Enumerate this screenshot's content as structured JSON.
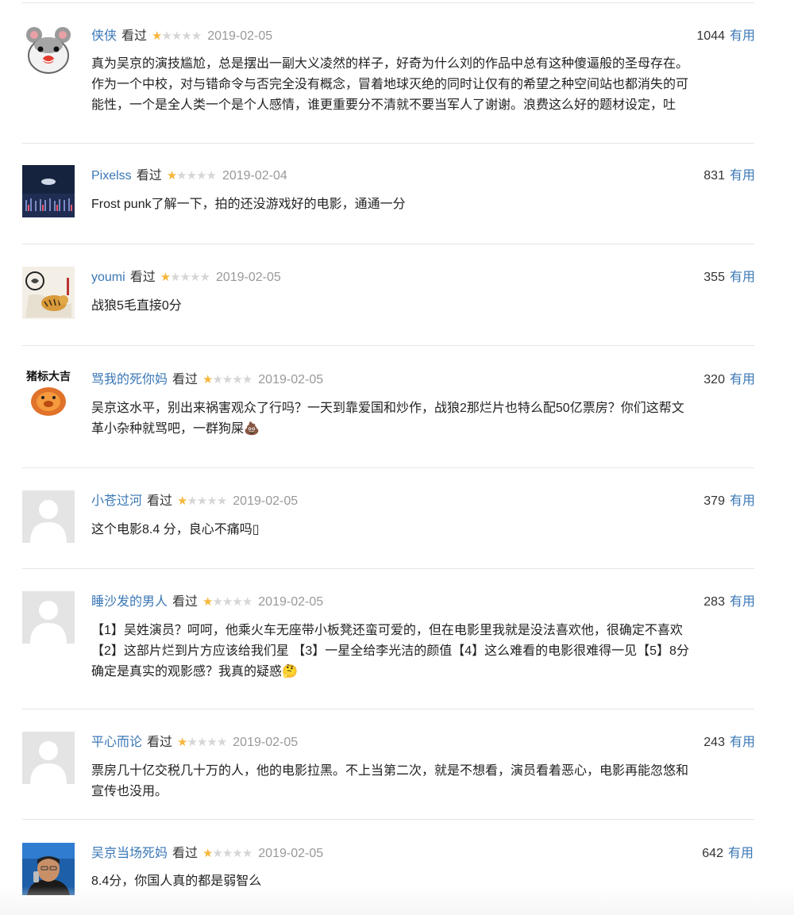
{
  "comments": [
    {
      "user": "侠侠",
      "seen": "看过",
      "stars": "★",
      "stars_off": "★★★★",
      "date": "2019-02-05",
      "count": "1044",
      "useful": "有用",
      "avatar": "hamster-avatar",
      "lines": [
        "真为吴京的演技尴尬，总是摆出一副大义凌然的样子，好奇为什么刘的作品中总有这种傻逼般的圣母存在。",
        "作为一个中校，对与错命令与否完全没有概念，冒着地球灭绝的同时让仅有的希望之种空间站也都消失的可",
        "能性，一个是全人类一个是个人感情，谁更重要分不清就不要当军人了谢谢。浪费这么好的题材设定，吐"
      ]
    },
    {
      "user": "Pixelss",
      "seen": "看过",
      "stars": "★",
      "stars_off": "★★★★",
      "date": "2019-02-04",
      "count": "831",
      "useful": "有用",
      "avatar": "night-scene-avatar",
      "lines": [
        "Frost punk了解一下，拍的还没游戏好的电影，通通一分"
      ]
    },
    {
      "user": "youmi",
      "seen": "看过",
      "stars": "★",
      "stars_off": "★★★★",
      "date": "2019-02-05",
      "count": "355",
      "useful": "有用",
      "avatar": "tiger-painting-avatar",
      "lines": [
        "战狼5毛直接0分"
      ]
    },
    {
      "user": "骂我的死你妈",
      "seen": "看过",
      "stars": "★",
      "stars_off": "★★★★",
      "date": "2019-02-05",
      "count": "320",
      "useful": "有用",
      "avatar": "pig-avatar",
      "avatar_text": "猪标大吉",
      "lines": [
        "吴京这水平，别出来祸害观众了行吗？一天到靠爱国和炒作，战狼2那烂片也特么配50亿票房？你们这帮文",
        "革小杂种就骂吧，一群狗屎💩"
      ]
    },
    {
      "user": "小苍过河",
      "seen": "看过",
      "stars": "★",
      "stars_off": "★★★★",
      "date": "2019-02-05",
      "count": "379",
      "useful": "有用",
      "avatar": "default-avatar",
      "lines": [
        "这个电影8.4 分，良心不痛吗▯"
      ]
    },
    {
      "user": "睡沙发的男人",
      "seen": "看过",
      "stars": "★",
      "stars_off": "★★★★",
      "date": "2019-02-05",
      "count": "283",
      "useful": "有用",
      "avatar": "default-avatar",
      "lines": [
        "【1】吴姓演员？呵呵，他乘火车无座带小板凳还蛮可爱的，但在电影里我就是没法喜欢他，很确定不喜欢",
        "【2】这部片烂到片方应该给我们星 【3】一星全给李光洁的颜值【4】这么难看的电影很难得一见【5】8分",
        "确定是真实的观影感？我真的疑惑🤔"
      ]
    },
    {
      "user": "平心而论",
      "seen": "看过",
      "stars": "★",
      "stars_off": "★★★★",
      "date": "2019-02-05",
      "count": "243",
      "useful": "有用",
      "avatar": "default-avatar",
      "lines": [
        "票房几十亿交税几十万的人，他的电影拉黑。不上当第二次，就是不想看，演员看着恶心，电影再能忽悠和",
        "宣传也没用。"
      ]
    },
    {
      "user": "吴京当场死妈",
      "seen": "看过",
      "stars": "★",
      "stars_off": "★★★★",
      "date": "2019-02-05",
      "count": "642",
      "useful": "有用",
      "avatar": "portrait-avatar",
      "lines": [
        "8.4分，你国人真的都是弱智么"
      ]
    }
  ]
}
